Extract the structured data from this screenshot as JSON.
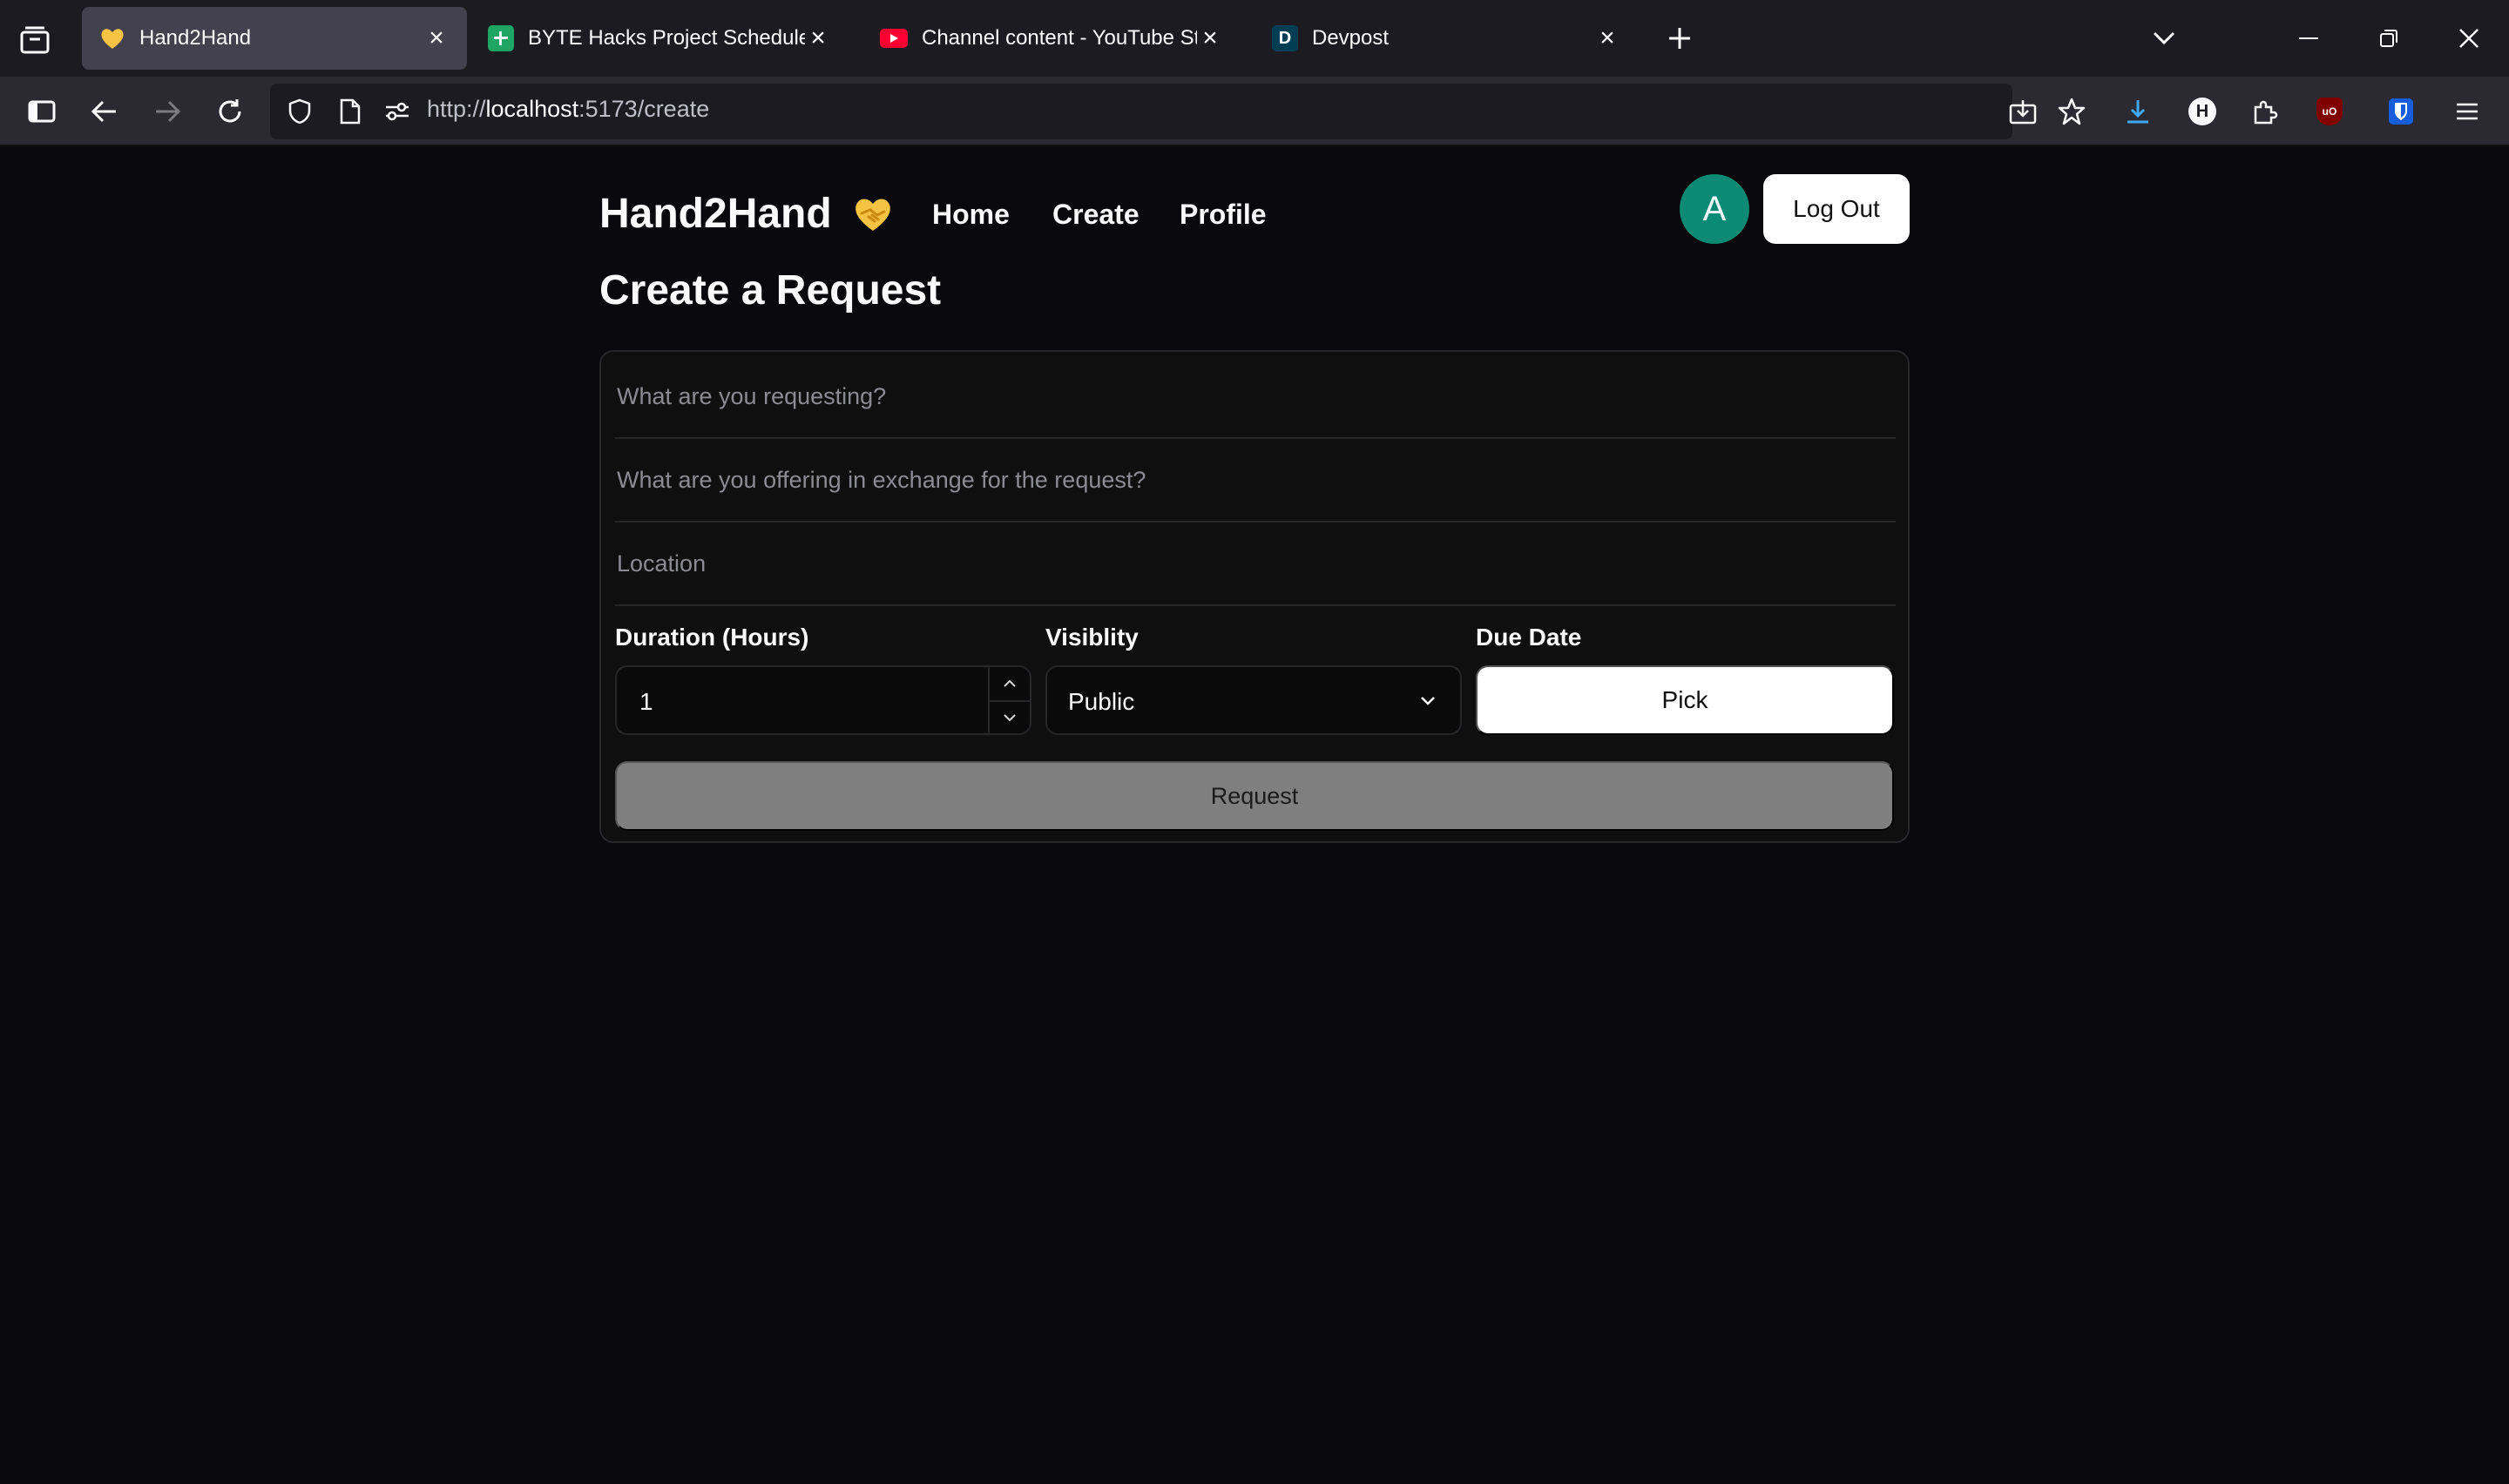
{
  "browser": {
    "tabs": [
      {
        "title": "Hand2Hand",
        "favicon": "handshake-heart-icon",
        "active": true
      },
      {
        "title": "BYTE Hacks Project Schedule - G",
        "favicon": "sheets-icon",
        "active": false
      },
      {
        "title": "Channel content - YouTube Stu",
        "favicon": "youtube-icon",
        "active": false
      },
      {
        "title": "Devpost",
        "favicon": "devpost-icon",
        "favicon_text": "D",
        "active": false
      }
    ],
    "url": {
      "scheme": "http://",
      "host": "localhost",
      "path": ":5173/create"
    },
    "extension_badge_h": "H",
    "extension_badge_ublock": "uO"
  },
  "app": {
    "brand": "Hand2Hand",
    "nav": [
      "Home",
      "Create",
      "Profile"
    ],
    "avatar_initial": "A",
    "logout_label": "Log Out",
    "page_title": "Create a Request"
  },
  "form": {
    "request_placeholder": "What are you requesting?",
    "offer_placeholder": "What are you offering in exchange for the request?",
    "location_placeholder": "Location",
    "duration_label": "Duration (Hours)",
    "duration_value": "1",
    "visibility_label": "Visiblity",
    "visibility_value": "Public",
    "due_date_label": "Due Date",
    "pick_label": "Pick",
    "submit_label": "Request"
  },
  "colors": {
    "background": "#09090b",
    "avatar": "#0d8a76",
    "submit_disabled": "#7f7f7f"
  }
}
